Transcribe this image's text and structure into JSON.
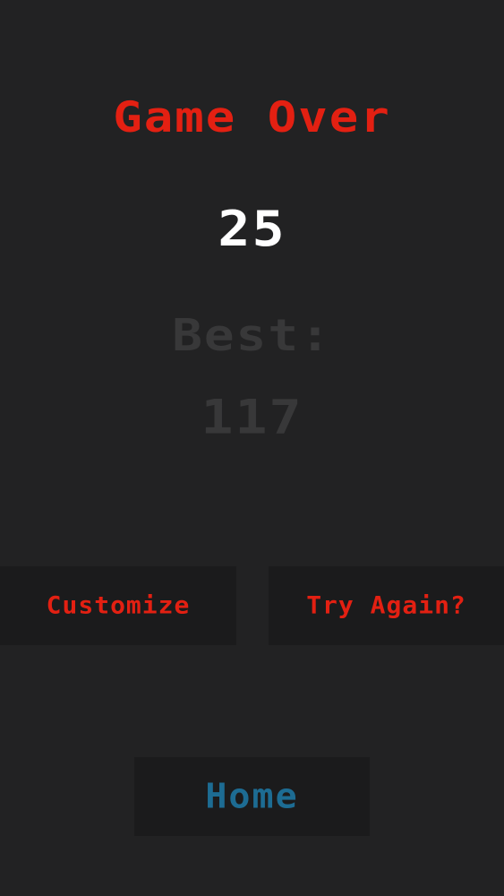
{
  "screen": {
    "title": "Game Over",
    "score": "25",
    "best_label": "Best:",
    "best_value": "117"
  },
  "buttons": {
    "customize": "Customize",
    "try_again": "Try Again?",
    "home": "Home"
  },
  "colors": {
    "background": "#222223",
    "button_bg": "#1b1b1c",
    "accent_red": "#e32012",
    "score_white": "#ffffff",
    "muted_gray": "#383839",
    "home_blue": "#1d6c93"
  }
}
